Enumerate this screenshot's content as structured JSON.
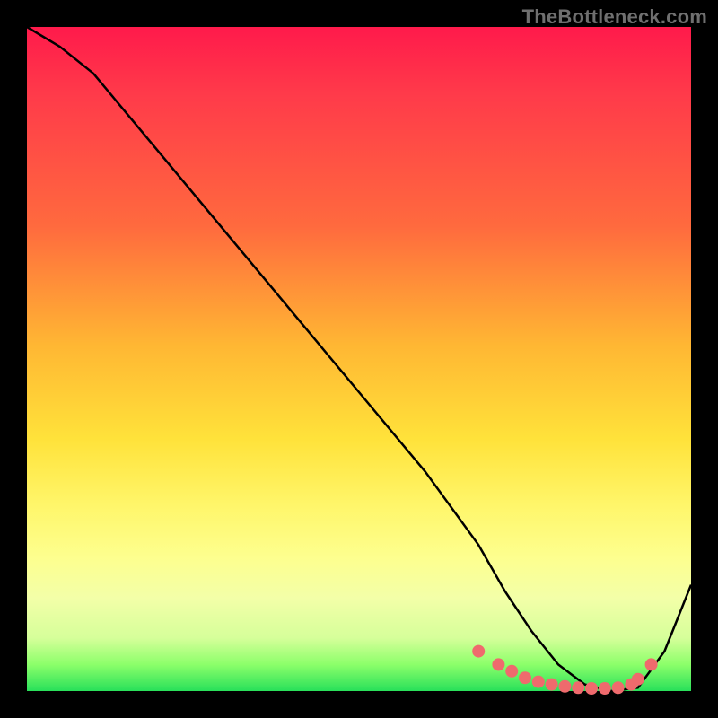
{
  "watermark": "TheBottleneck.com",
  "chart_data": {
    "type": "line",
    "title": "",
    "xlabel": "",
    "ylabel": "",
    "xlim": [
      0,
      100
    ],
    "ylim": [
      0,
      100
    ],
    "note": "Axis ticks and numeric labels are not rendered in the image; values below are estimated from the curve shape relative to the plot area.",
    "series": [
      {
        "name": "curve",
        "x": [
          0,
          5,
          10,
          20,
          30,
          40,
          50,
          60,
          68,
          72,
          76,
          80,
          84,
          88,
          92,
          96,
          100
        ],
        "values": [
          100,
          97,
          93,
          81,
          69,
          57,
          45,
          33,
          22,
          15,
          9,
          4,
          1,
          0,
          0.5,
          6,
          16
        ]
      }
    ],
    "markers": {
      "name": "trough-markers",
      "color": "#ef6a6d",
      "radius_px": 7,
      "x": [
        68,
        71,
        73,
        75,
        77,
        79,
        81,
        83,
        85,
        87,
        89,
        91,
        92,
        94
      ],
      "values": [
        6,
        4,
        3,
        2,
        1.4,
        1,
        0.7,
        0.5,
        0.4,
        0.4,
        0.5,
        1,
        1.8,
        4
      ]
    },
    "background_gradient": {
      "direction": "top-to-bottom",
      "stops": [
        {
          "pos": 0.0,
          "color": "#ff1a4b"
        },
        {
          "pos": 0.3,
          "color": "#ff6a3e"
        },
        {
          "pos": 0.62,
          "color": "#ffe23a"
        },
        {
          "pos": 0.86,
          "color": "#f3ffa8"
        },
        {
          "pos": 1.0,
          "color": "#28e05a"
        }
      ]
    }
  }
}
